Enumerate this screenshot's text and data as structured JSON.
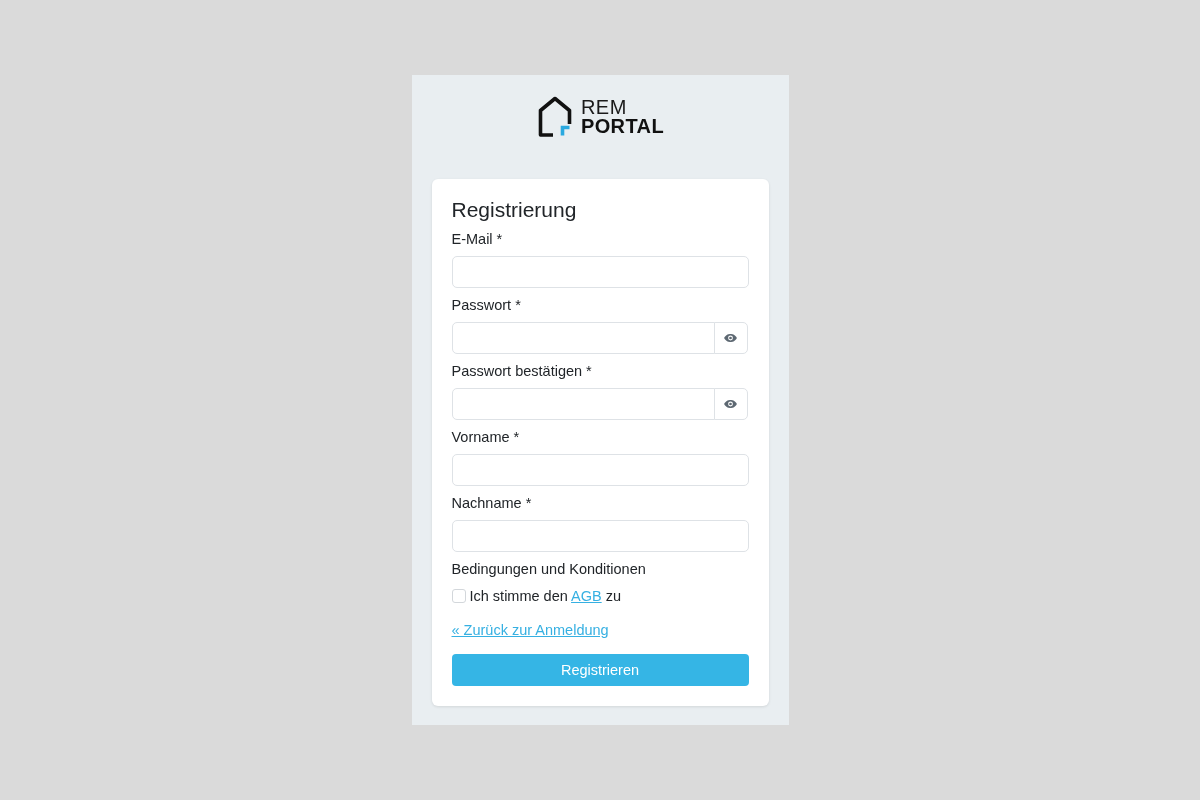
{
  "logo": {
    "line_1": "REM",
    "line_2": "PORTAL"
  },
  "form": {
    "title": "Registrierung",
    "fields": [
      {
        "label": "E-Mail *",
        "kind": "text"
      },
      {
        "label": "Passwort *",
        "kind": "password"
      },
      {
        "label": "Passwort bestätigen *",
        "kind": "password"
      },
      {
        "label": "Vorname *",
        "kind": "text"
      },
      {
        "label": "Nachname *",
        "kind": "text"
      }
    ],
    "terms": {
      "heading": "Bedingungen und Konditionen",
      "checked": false,
      "text_before": "Ich stimme den",
      "link": "AGB",
      "text_after": "zu"
    },
    "back_link": "« Zurück zur Anmeldung",
    "submit": "Registrieren"
  }
}
